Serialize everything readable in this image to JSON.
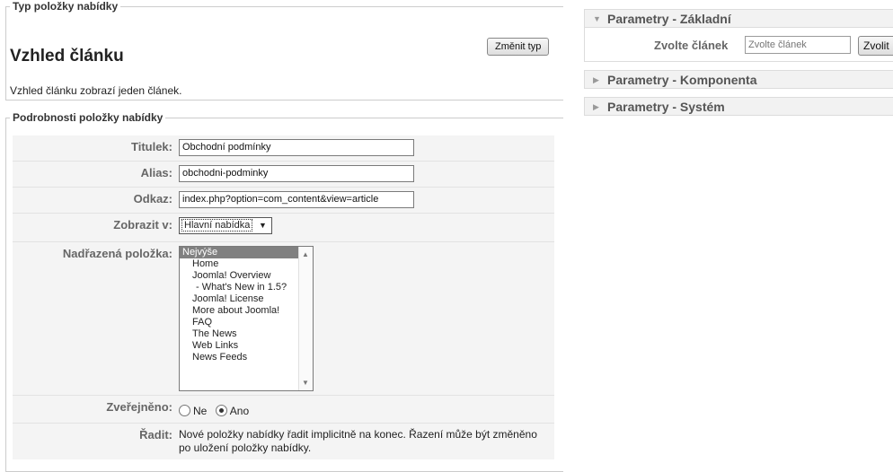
{
  "typ": {
    "legend": "Typ položky nabídky",
    "title": "Vzhled článku",
    "change_button": "Změnit typ",
    "description": "Vzhled článku zobrazí jeden článek."
  },
  "details": {
    "legend": "Podrobnosti položky nabídky",
    "titulek": {
      "label": "Titulek:",
      "value": "Obchodní podmínky"
    },
    "alias": {
      "label": "Alias:",
      "value": "obchodni-podminky"
    },
    "odkaz": {
      "label": "Odkaz:",
      "value": "index.php?option=com_content&view=article"
    },
    "zobrazit": {
      "label": "Zobrazit v:",
      "value": "Hlavní nabídka"
    },
    "nadrazena": {
      "label": "Nadřazená položka:",
      "options": [
        "Nejvýše",
        "Home",
        "Joomla! Overview",
        "- What's New in 1.5?",
        "Joomla! License",
        "More about Joomla!",
        "FAQ",
        "The News",
        "Web Links",
        "News Feeds"
      ],
      "selected": "Nejvýše"
    },
    "zverejneno": {
      "label": "Zveřejněno:",
      "option_no": "Ne",
      "option_yes": "Ano",
      "selected": "Ano"
    },
    "radit": {
      "label": "Řadit:",
      "text": "Nové položky nabídky řadit implicitně na konec. Řazení může být změněno po uložení položky nabídky."
    }
  },
  "panels": {
    "zakladni": {
      "title": "Parametry - Základní",
      "field_label": "Zvolte článek",
      "placeholder": "Zvolte článek",
      "button": "Zvolit"
    },
    "komponenta": {
      "title": "Parametry - Komponenta"
    },
    "system": {
      "title": "Parametry - Systém"
    }
  }
}
